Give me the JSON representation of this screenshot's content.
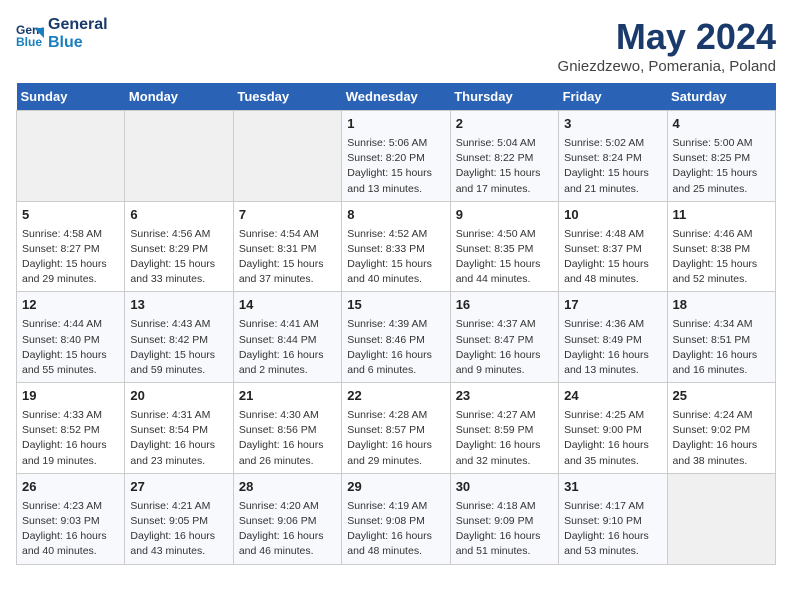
{
  "header": {
    "logo_line1": "General",
    "logo_line2": "Blue",
    "title": "May 2024",
    "subtitle": "Gniezdzewo, Pomerania, Poland"
  },
  "days_of_week": [
    "Sunday",
    "Monday",
    "Tuesday",
    "Wednesday",
    "Thursday",
    "Friday",
    "Saturday"
  ],
  "weeks": [
    [
      {
        "day": "",
        "data": ""
      },
      {
        "day": "",
        "data": ""
      },
      {
        "day": "",
        "data": ""
      },
      {
        "day": "1",
        "data": "Sunrise: 5:06 AM\nSunset: 8:20 PM\nDaylight: 15 hours\nand 13 minutes."
      },
      {
        "day": "2",
        "data": "Sunrise: 5:04 AM\nSunset: 8:22 PM\nDaylight: 15 hours\nand 17 minutes."
      },
      {
        "day": "3",
        "data": "Sunrise: 5:02 AM\nSunset: 8:24 PM\nDaylight: 15 hours\nand 21 minutes."
      },
      {
        "day": "4",
        "data": "Sunrise: 5:00 AM\nSunset: 8:25 PM\nDaylight: 15 hours\nand 25 minutes."
      }
    ],
    [
      {
        "day": "5",
        "data": "Sunrise: 4:58 AM\nSunset: 8:27 PM\nDaylight: 15 hours\nand 29 minutes."
      },
      {
        "day": "6",
        "data": "Sunrise: 4:56 AM\nSunset: 8:29 PM\nDaylight: 15 hours\nand 33 minutes."
      },
      {
        "day": "7",
        "data": "Sunrise: 4:54 AM\nSunset: 8:31 PM\nDaylight: 15 hours\nand 37 minutes."
      },
      {
        "day": "8",
        "data": "Sunrise: 4:52 AM\nSunset: 8:33 PM\nDaylight: 15 hours\nand 40 minutes."
      },
      {
        "day": "9",
        "data": "Sunrise: 4:50 AM\nSunset: 8:35 PM\nDaylight: 15 hours\nand 44 minutes."
      },
      {
        "day": "10",
        "data": "Sunrise: 4:48 AM\nSunset: 8:37 PM\nDaylight: 15 hours\nand 48 minutes."
      },
      {
        "day": "11",
        "data": "Sunrise: 4:46 AM\nSunset: 8:38 PM\nDaylight: 15 hours\nand 52 minutes."
      }
    ],
    [
      {
        "day": "12",
        "data": "Sunrise: 4:44 AM\nSunset: 8:40 PM\nDaylight: 15 hours\nand 55 minutes."
      },
      {
        "day": "13",
        "data": "Sunrise: 4:43 AM\nSunset: 8:42 PM\nDaylight: 15 hours\nand 59 minutes."
      },
      {
        "day": "14",
        "data": "Sunrise: 4:41 AM\nSunset: 8:44 PM\nDaylight: 16 hours\nand 2 minutes."
      },
      {
        "day": "15",
        "data": "Sunrise: 4:39 AM\nSunset: 8:46 PM\nDaylight: 16 hours\nand 6 minutes."
      },
      {
        "day": "16",
        "data": "Sunrise: 4:37 AM\nSunset: 8:47 PM\nDaylight: 16 hours\nand 9 minutes."
      },
      {
        "day": "17",
        "data": "Sunrise: 4:36 AM\nSunset: 8:49 PM\nDaylight: 16 hours\nand 13 minutes."
      },
      {
        "day": "18",
        "data": "Sunrise: 4:34 AM\nSunset: 8:51 PM\nDaylight: 16 hours\nand 16 minutes."
      }
    ],
    [
      {
        "day": "19",
        "data": "Sunrise: 4:33 AM\nSunset: 8:52 PM\nDaylight: 16 hours\nand 19 minutes."
      },
      {
        "day": "20",
        "data": "Sunrise: 4:31 AM\nSunset: 8:54 PM\nDaylight: 16 hours\nand 23 minutes."
      },
      {
        "day": "21",
        "data": "Sunrise: 4:30 AM\nSunset: 8:56 PM\nDaylight: 16 hours\nand 26 minutes."
      },
      {
        "day": "22",
        "data": "Sunrise: 4:28 AM\nSunset: 8:57 PM\nDaylight: 16 hours\nand 29 minutes."
      },
      {
        "day": "23",
        "data": "Sunrise: 4:27 AM\nSunset: 8:59 PM\nDaylight: 16 hours\nand 32 minutes."
      },
      {
        "day": "24",
        "data": "Sunrise: 4:25 AM\nSunset: 9:00 PM\nDaylight: 16 hours\nand 35 minutes."
      },
      {
        "day": "25",
        "data": "Sunrise: 4:24 AM\nSunset: 9:02 PM\nDaylight: 16 hours\nand 38 minutes."
      }
    ],
    [
      {
        "day": "26",
        "data": "Sunrise: 4:23 AM\nSunset: 9:03 PM\nDaylight: 16 hours\nand 40 minutes."
      },
      {
        "day": "27",
        "data": "Sunrise: 4:21 AM\nSunset: 9:05 PM\nDaylight: 16 hours\nand 43 minutes."
      },
      {
        "day": "28",
        "data": "Sunrise: 4:20 AM\nSunset: 9:06 PM\nDaylight: 16 hours\nand 46 minutes."
      },
      {
        "day": "29",
        "data": "Sunrise: 4:19 AM\nSunset: 9:08 PM\nDaylight: 16 hours\nand 48 minutes."
      },
      {
        "day": "30",
        "data": "Sunrise: 4:18 AM\nSunset: 9:09 PM\nDaylight: 16 hours\nand 51 minutes."
      },
      {
        "day": "31",
        "data": "Sunrise: 4:17 AM\nSunset: 9:10 PM\nDaylight: 16 hours\nand 53 minutes."
      },
      {
        "day": "",
        "data": ""
      }
    ]
  ]
}
